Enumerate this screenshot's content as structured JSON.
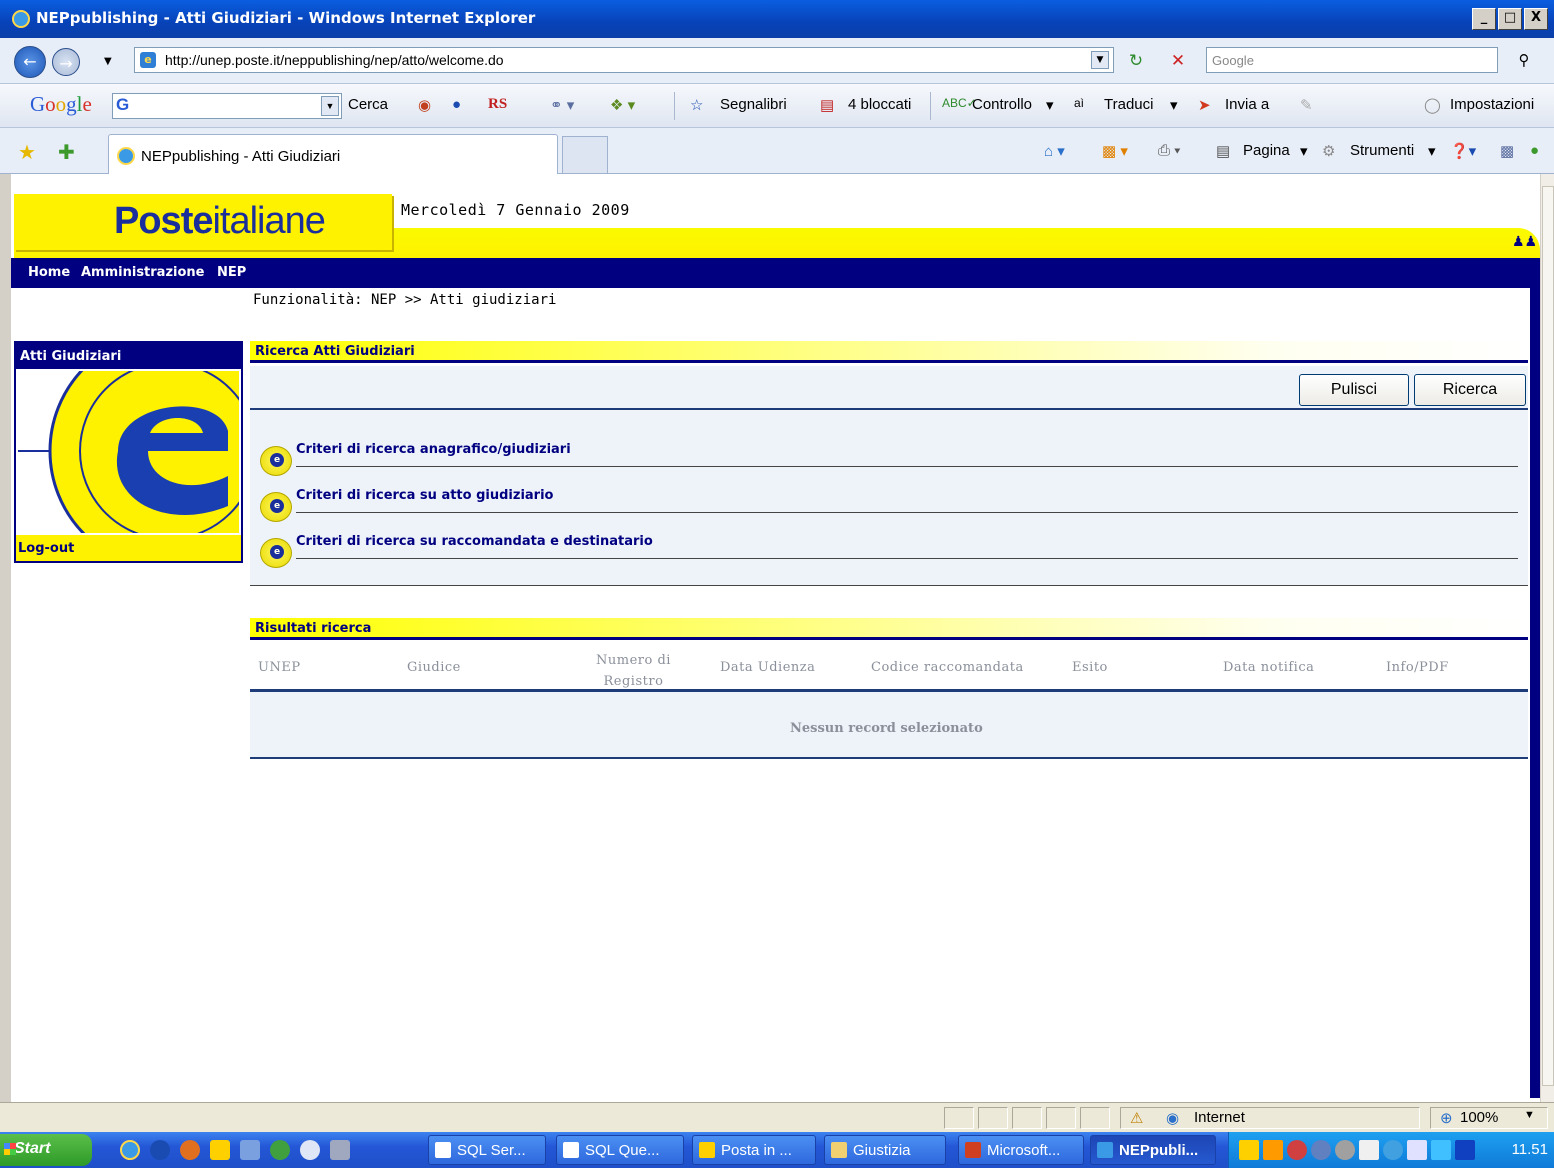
{
  "window": {
    "title": "NEPpublishing - Atti Giudiziari - Windows Internet Explorer",
    "controls": [
      "_",
      "□",
      "X"
    ]
  },
  "address": {
    "url": "http://unep.poste.it/neppublishing/nep/atto/welcome.do",
    "search_placeholder": "Google"
  },
  "google_toolbar": {
    "logo": [
      "G",
      "o",
      "o",
      "g",
      "l",
      "e"
    ],
    "search_label": "Cerca",
    "rs": "RS",
    "bookmarks": "Segnalibri",
    "blocked": "4 bloccati",
    "spellcheck": "Controllo",
    "translate": "Traduci",
    "send": "Invia a",
    "settings": "Impostazioni"
  },
  "tab_bar": {
    "tab_title": "NEPpublishing - Atti Giudiziari",
    "page_menu": "Pagina",
    "tools_menu": "Strumenti"
  },
  "page": {
    "logo": {
      "bold": "Poste",
      "regular": "italiane"
    },
    "date": "Mercoledì 7 Gennaio 2009",
    "menu": [
      "Home",
      "Amministrazione",
      "NEP"
    ],
    "breadcrumb": "Funzionalità: NEP >> Atti giudiziari",
    "sidebar": {
      "title": "Atti Giudiziari",
      "logout": "Log-out"
    },
    "search_panel": {
      "title": "Ricerca Atti Giudiziari",
      "clear_button": "Pulisci",
      "search_button": "Ricerca",
      "criteria": [
        "Criteri di ricerca anagrafico/giudiziari",
        "Criteri di ricerca su atto giudiziario",
        "Criteri di ricerca su raccomandata e destinatario"
      ]
    },
    "results_panel": {
      "title": "Risultati ricerca",
      "columns": [
        "UNEP",
        "Giudice",
        "Numero di",
        "Registro",
        "Data Udienza",
        "Codice raccomandata",
        "Esito",
        "Data notifica",
        "Info/PDF"
      ],
      "empty_message": "Nessun record selezionato"
    }
  },
  "status_bar": {
    "zone": "Internet",
    "zoom": "100%"
  },
  "taskbar": {
    "start": "Start",
    "buttons": [
      "SQL Ser...",
      "SQL Que...",
      "Posta in ...",
      "Giustizia",
      "Microsoft...",
      "NEPpubli..."
    ],
    "clock": "11.51"
  },
  "colors": {
    "poste_yellow": "#fff200",
    "poste_blue": "#000080",
    "panel_bg": "#eef3fa"
  }
}
